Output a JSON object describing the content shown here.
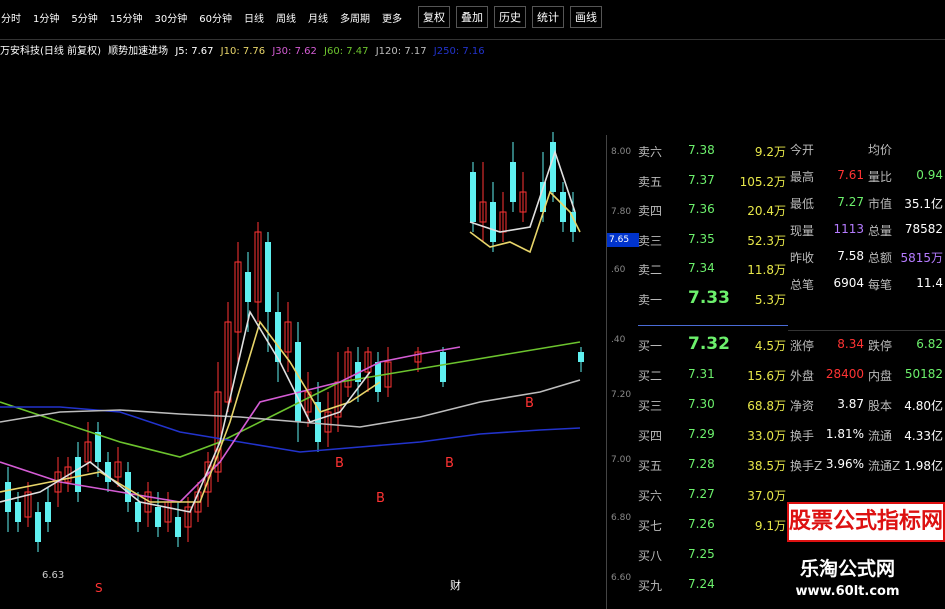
{
  "toolbar": {
    "periods": [
      "分时",
      "1分钟",
      "5分钟",
      "15分钟",
      "30分钟",
      "60分钟",
      "日线",
      "周线",
      "月线",
      "多周期",
      "更多"
    ],
    "actions": [
      "复权",
      "叠加",
      "历史",
      "统计",
      "画线"
    ]
  },
  "legend": {
    "stock": "万安科技(日线 前复权)",
    "signal": "顺势加速进场",
    "ma5": "J5: 7.67",
    "ma10": "J10: 7.76",
    "ma30": "J30: 7.62",
    "ma60": "J60: 7.47",
    "ma120": "J120: 7.17",
    "ma250": "J250: 7.16"
  },
  "axis": {
    "ticks": [
      "8.00",
      "7.80",
      "7.65",
      ".60",
      ".40",
      "7.20",
      "7.00",
      "6.80",
      "6.60"
    ],
    "current": "7.65"
  },
  "chart_annotations": {
    "low_marker": "6.63",
    "b_labels": [
      "B",
      "B",
      "B",
      "B"
    ],
    "s_label": "S",
    "cai_label": "财"
  },
  "orderbook": {
    "asks": [
      {
        "label": "卖六",
        "price": "7.38",
        "vol": "9.2万"
      },
      {
        "label": "卖五",
        "price": "7.37",
        "vol": "105.2万"
      },
      {
        "label": "卖四",
        "price": "7.36",
        "vol": "20.4万"
      },
      {
        "label": "卖三",
        "price": "7.35",
        "vol": "52.3万"
      },
      {
        "label": "卖二",
        "price": "7.34",
        "vol": "11.8万"
      },
      {
        "label": "卖一",
        "price": "7.33",
        "vol": "5.3万"
      }
    ],
    "bids": [
      {
        "label": "买一",
        "price": "7.32",
        "vol": "4.5万"
      },
      {
        "label": "买二",
        "price": "7.31",
        "vol": "15.6万"
      },
      {
        "label": "买三",
        "price": "7.30",
        "vol": "68.8万"
      },
      {
        "label": "买四",
        "price": "7.29",
        "vol": "33.0万"
      },
      {
        "label": "买五",
        "price": "7.28",
        "vol": "38.5万"
      },
      {
        "label": "买六",
        "price": "7.27",
        "vol": "37.0万"
      },
      {
        "label": "买七",
        "price": "7.26",
        "vol": "9.1万"
      },
      {
        "label": "买八",
        "price": "7.25",
        "vol": "3.0万"
      },
      {
        "label": "买九",
        "price": "7.24",
        "vol": ""
      }
    ]
  },
  "stats": {
    "rows": [
      {
        "k": "今开",
        "v1": "",
        "k2": "均价",
        "v2": ""
      },
      {
        "k": "最高",
        "v1": "7.61",
        "k2": "量比",
        "v2": "0.94"
      },
      {
        "k": "最低",
        "v1": "7.27",
        "k2": "市值",
        "v2": "35.1亿"
      },
      {
        "k": "现量",
        "v1": "1113",
        "k2": "总量",
        "v2": "78582"
      },
      {
        "k": "昨收",
        "v1": "7.58",
        "k2": "总额",
        "v2": "5815万"
      },
      {
        "k": "总笔",
        "v1": "6904",
        "k2": "每笔",
        "v2": "11.4"
      },
      {
        "k": "涨停",
        "v1": "8.34",
        "k2": "跌停",
        "v2": "6.82"
      },
      {
        "k": "外盘",
        "v1": "28400",
        "k2": "内盘",
        "v2": "50182"
      },
      {
        "k": "净资",
        "v1": "3.87",
        "k2": "股本",
        "v2": "4.80亿"
      },
      {
        "k": "换手",
        "v1": "1.81%",
        "k2": "流通",
        "v2": "4.33亿"
      },
      {
        "k": "换手Z",
        "v1": "3.96%",
        "k2": "流通Z",
        "v2": "1.98亿"
      }
    ]
  },
  "watermark": {
    "brand": "股票公式指标网",
    "site_name": "乐淘公式网",
    "url": "www.60lt.com"
  },
  "colors": {
    "up": "#ff3333",
    "down": "#5ff0f0",
    "ma_white": "#e0e0e0",
    "ma_yellow": "#e8d56a",
    "ma_magenta": "#d45cd4",
    "ma_green": "#6cc32e",
    "ma_blue": "#2233cc",
    "ma_gray": "#bdbdbd"
  }
}
